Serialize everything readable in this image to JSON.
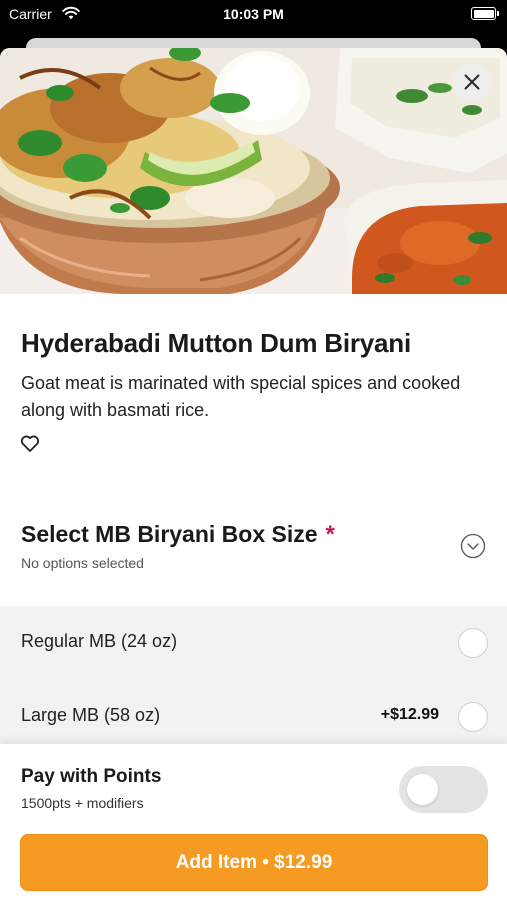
{
  "status_bar": {
    "carrier": "Carrier",
    "time": "10:03 PM"
  },
  "item": {
    "title": "Hyderabadi Mutton Dum Biryani",
    "description": "Goat meat is marinated with special spices and cooked along with basmati rice."
  },
  "size_section": {
    "title": "Select MB Biryani Box Size",
    "required_marker": "*",
    "subtitle": "No options selected",
    "options": [
      {
        "label": "Regular MB (24 oz)",
        "price": ""
      },
      {
        "label": "Large MB (58 oz)",
        "price": "+$12.99"
      }
    ]
  },
  "points": {
    "title": "Pay with Points",
    "subtitle": "1500pts + modifiers",
    "enabled": false
  },
  "add_button": {
    "label": "Add Item • $12.99"
  },
  "colors": {
    "accent": "#f59a23",
    "required": "#c4184f"
  },
  "icons": [
    "wifi-icon",
    "battery-icon",
    "close-icon",
    "heart-icon",
    "chevron-down-icon"
  ]
}
